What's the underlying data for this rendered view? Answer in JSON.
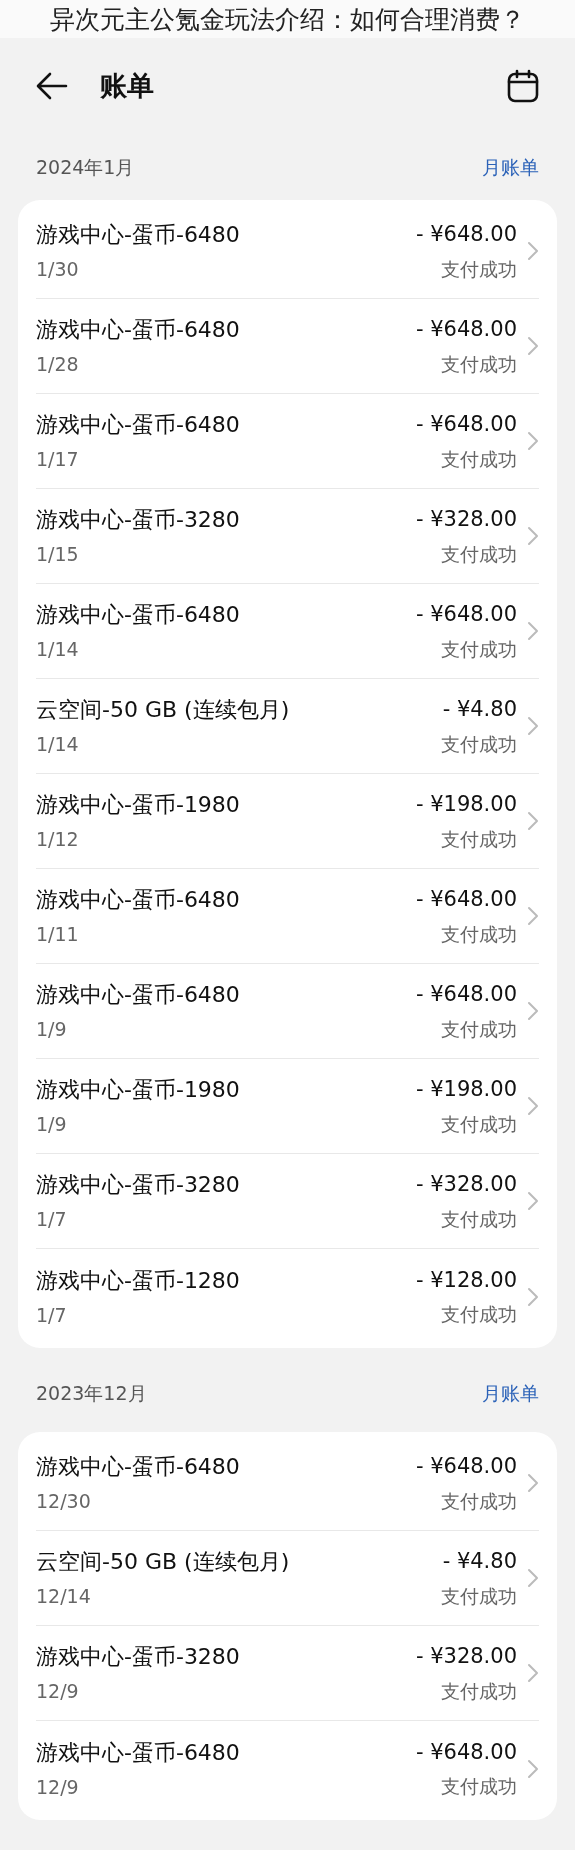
{
  "caption": "异次元主公氪金玩法介绍：如何合理消费？",
  "header": {
    "title": "账单"
  },
  "sections": [
    {
      "month": "2024年1月",
      "link": "月账单",
      "items": [
        {
          "title": "游戏中心-蛋币-6480",
          "date": "1/30",
          "amount": "- ¥648.00",
          "status": "支付成功"
        },
        {
          "title": "游戏中心-蛋币-6480",
          "date": "1/28",
          "amount": "- ¥648.00",
          "status": "支付成功"
        },
        {
          "title": "游戏中心-蛋币-6480",
          "date": "1/17",
          "amount": "- ¥648.00",
          "status": "支付成功"
        },
        {
          "title": "游戏中心-蛋币-3280",
          "date": "1/15",
          "amount": "- ¥328.00",
          "status": "支付成功"
        },
        {
          "title": "游戏中心-蛋币-6480",
          "date": "1/14",
          "amount": "- ¥648.00",
          "status": "支付成功"
        },
        {
          "title": "云空间-50 GB (连续包月)",
          "date": "1/14",
          "amount": "- ¥4.80",
          "status": "支付成功"
        },
        {
          "title": "游戏中心-蛋币-1980",
          "date": "1/12",
          "amount": "- ¥198.00",
          "status": "支付成功"
        },
        {
          "title": "游戏中心-蛋币-6480",
          "date": "1/11",
          "amount": "- ¥648.00",
          "status": "支付成功"
        },
        {
          "title": "游戏中心-蛋币-6480",
          "date": "1/9",
          "amount": "- ¥648.00",
          "status": "支付成功"
        },
        {
          "title": "游戏中心-蛋币-1980",
          "date": "1/9",
          "amount": "- ¥198.00",
          "status": "支付成功"
        },
        {
          "title": "游戏中心-蛋币-3280",
          "date": "1/7",
          "amount": "- ¥328.00",
          "status": "支付成功"
        },
        {
          "title": "游戏中心-蛋币-1280",
          "date": "1/7",
          "amount": "- ¥128.00",
          "status": "支付成功"
        }
      ]
    },
    {
      "month": "2023年12月",
      "link": "月账单",
      "items": [
        {
          "title": "游戏中心-蛋币-6480",
          "date": "12/30",
          "amount": "- ¥648.00",
          "status": "支付成功"
        },
        {
          "title": "云空间-50 GB (连续包月)",
          "date": "12/14",
          "amount": "- ¥4.80",
          "status": "支付成功"
        },
        {
          "title": "游戏中心-蛋币-3280",
          "date": "12/9",
          "amount": "- ¥328.00",
          "status": "支付成功"
        },
        {
          "title": "游戏中心-蛋币-6480",
          "date": "12/9",
          "amount": "- ¥648.00",
          "status": "支付成功"
        }
      ]
    }
  ]
}
